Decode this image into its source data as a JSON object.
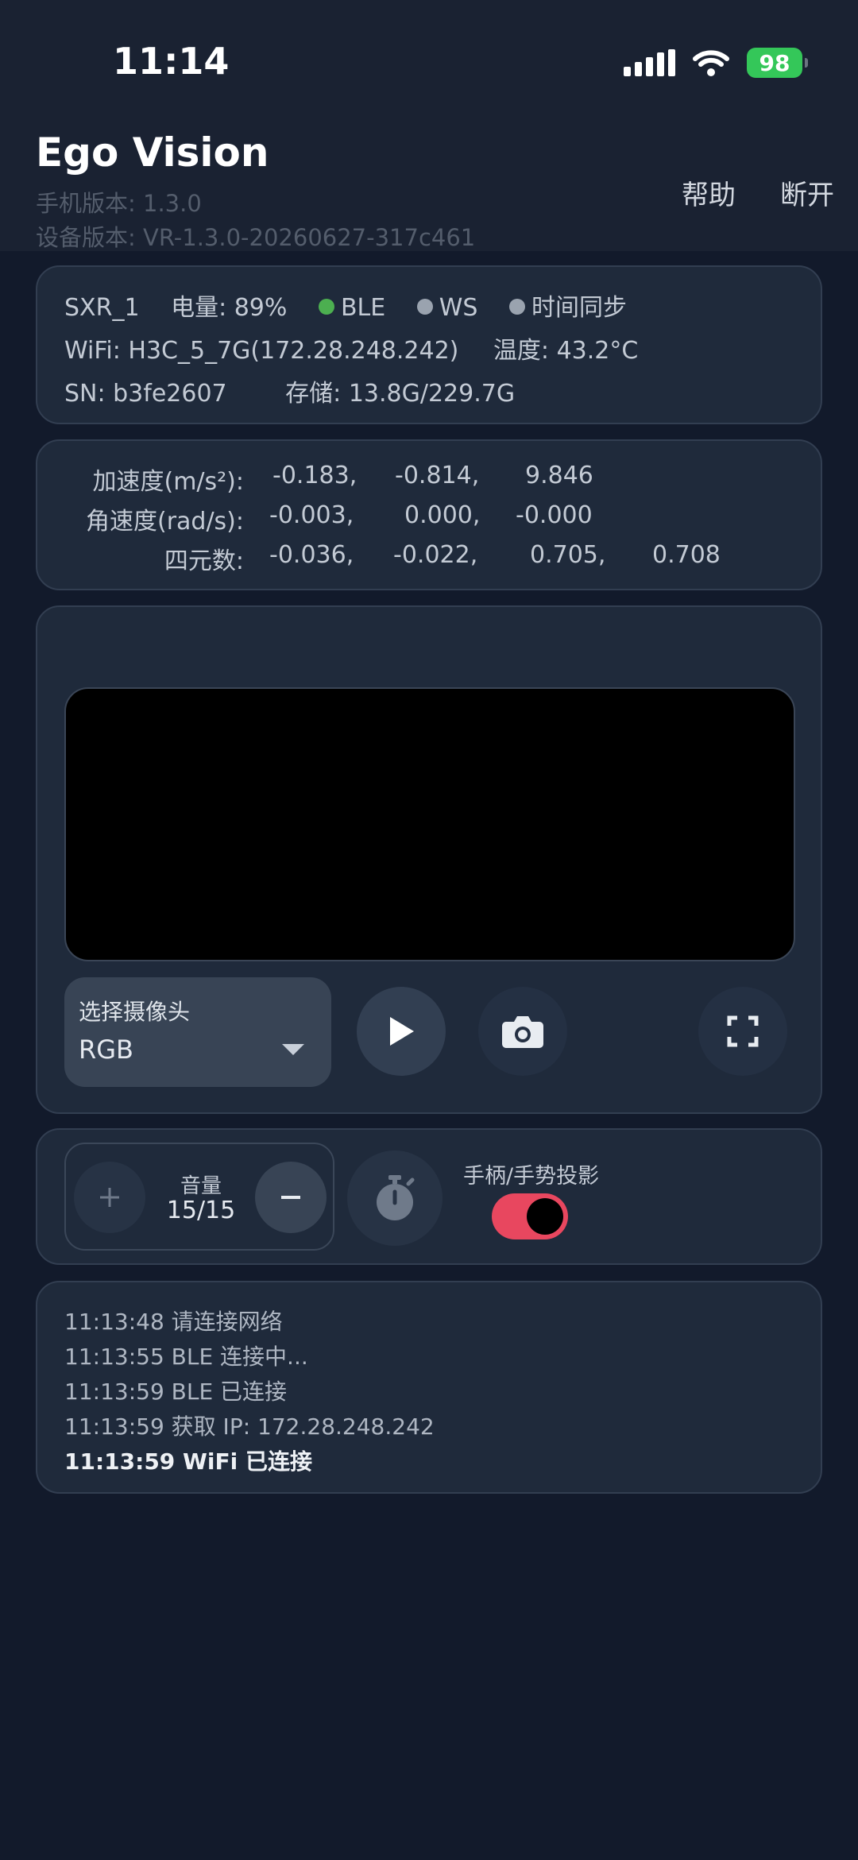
{
  "status_bar": {
    "time": "11:14",
    "battery": "98"
  },
  "header": {
    "title": "Ego Vision",
    "phone_version": "手机版本: 1.3.0",
    "device_version": "设备版本: VR-1.3.0-20260627-317c461",
    "help_label": "帮助",
    "disconnect_label": "断开"
  },
  "device": {
    "name": "SXR_1",
    "battery": "电量: 89%",
    "ble": "BLE",
    "ws": "WS",
    "time_sync": "时间同步",
    "wifi": "WiFi: H3C_5_7G(172.28.248.242)",
    "temperature": "温度: 43.2°C",
    "sn": "SN: b3fe2607",
    "storage": "存储: 13.8G/229.7G",
    "colors": {
      "ble_dot": "#4caf50",
      "ws_dot": "#9aa3af",
      "sync_dot": "#9aa3af"
    }
  },
  "imu": {
    "accel_label": "加速度(m/s²):",
    "accel": [
      "-0.183,",
      "-0.814,",
      "9.846"
    ],
    "gyro_label": "角速度(rad/s):",
    "gyro": [
      "-0.003,",
      "0.000,",
      "-0.000"
    ],
    "quat_label": "四元数:",
    "quat": [
      "-0.036,",
      "-0.022,",
      "0.705,",
      "0.708"
    ]
  },
  "camera": {
    "select_label": "选择摄像头",
    "selected": "RGB",
    "icons": [
      "play-icon",
      "camera-icon",
      "fullscreen-icon"
    ]
  },
  "controls": {
    "volume_label": "音量",
    "volume_value": "15/15",
    "toggle_label": "手柄/手势投影",
    "toggle_on": true,
    "toggle_color": "#e8475f"
  },
  "log": [
    "11:13:48 请连接网络",
    "11:13:55 BLE 连接中...",
    "11:13:59 BLE 已连接",
    "11:13:59 获取 IP: 172.28.248.242",
    "11:13:59 WiFi 已连接"
  ]
}
